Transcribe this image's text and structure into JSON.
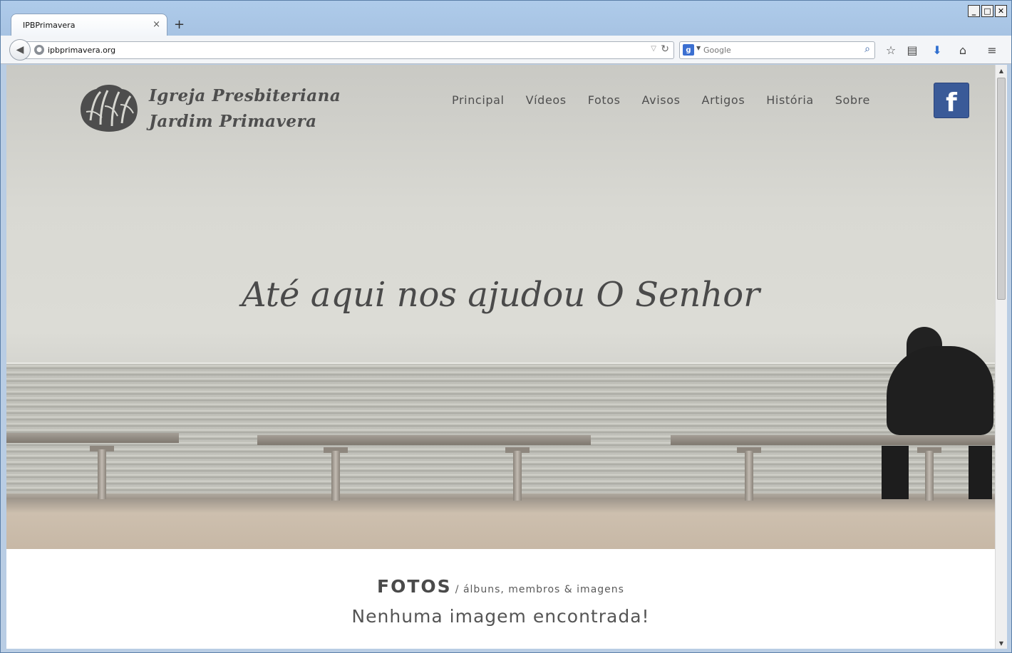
{
  "browser": {
    "tab_title": "IPBPrimavera",
    "tab_close": "×",
    "new_tab": "+",
    "url": "ipbprimavera.org",
    "search_placeholder": "Google",
    "search_engine_letter": "g",
    "window_controls": {
      "minimize": "_",
      "maximize": "□",
      "close": "✕"
    }
  },
  "site": {
    "logo_line1": "Igreja Presbiteriana",
    "logo_line2": "Jardim Primavera",
    "nav": [
      "Principal",
      "Vídeos",
      "Fotos",
      "Avisos",
      "Artigos",
      "História",
      "Sobre"
    ],
    "facebook_label": "f",
    "hero_slogan": "Até aqui nos ajudou O Senhor",
    "section_title": "FOTOS",
    "section_subtitle": "/ álbuns, membros & imagens",
    "empty_message": "Nenhuma imagem encontrada!"
  },
  "icons": {
    "back": "back-arrow-icon",
    "reload": "reload-icon",
    "bookmark": "star-icon",
    "reading_list": "clipboard-icon",
    "download": "download-arrow-icon",
    "home": "home-icon",
    "menu": "hamburger-menu-icon",
    "search": "magnifier-icon"
  },
  "colors": {
    "facebook_blue": "#3a5a98",
    "browser_chrome": "#aecbea",
    "text_gray": "#4e4e4e"
  }
}
